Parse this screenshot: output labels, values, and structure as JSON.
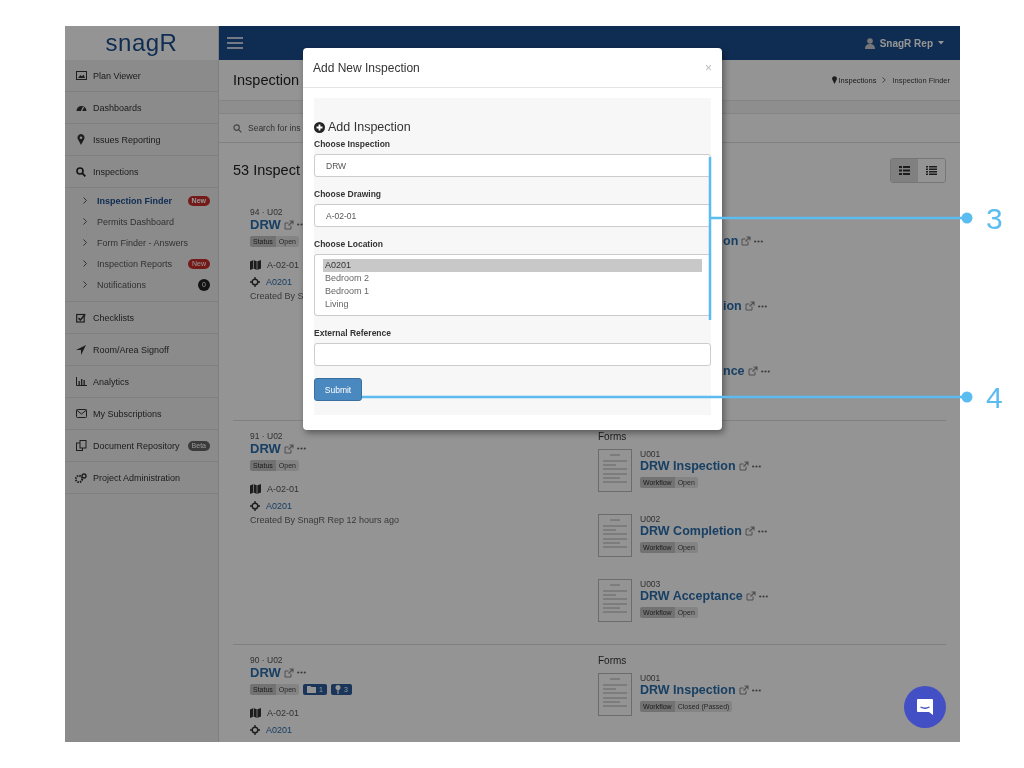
{
  "header": {
    "user": "SnagR Rep"
  },
  "sidebar": {
    "logo": "snagR",
    "items": [
      {
        "label": "Plan Viewer",
        "selected": false
      },
      {
        "label": "Dashboards",
        "selected": false
      },
      {
        "label": "Issues Reporting",
        "selected": false
      },
      {
        "label": "Inspections",
        "selected": false,
        "children": [
          {
            "label": "Inspection Finder",
            "selected": true,
            "badge": {
              "text": "New",
              "kind": "new"
            }
          },
          {
            "label": "Permits Dashboard",
            "selected": false
          },
          {
            "label": "Form Finder - Answers",
            "selected": false
          },
          {
            "label": "Inspection Reports",
            "selected": false,
            "badge": {
              "text": "New",
              "kind": "new"
            }
          },
          {
            "label": "Notifications",
            "selected": false,
            "badge": {
              "text": "0",
              "kind": "count"
            }
          }
        ]
      },
      {
        "label": "Checklists",
        "selected": false
      },
      {
        "label": "Room/Area Signoff",
        "selected": false
      },
      {
        "label": "Analytics",
        "selected": false
      },
      {
        "label": "My Subscriptions",
        "selected": false
      },
      {
        "label": "Document Repository",
        "selected": false,
        "badge": {
          "text": "Beta",
          "kind": "beta"
        }
      },
      {
        "label": "Project Administration",
        "selected": false
      }
    ]
  },
  "page": {
    "title": "Inspection",
    "breadcrumb": [
      "Inspections",
      "Inspection Finder"
    ],
    "search": {
      "placeholder": "Search for ins"
    },
    "count": "53 Inspect",
    "view_toggle": [
      {
        "selected": true
      },
      {
        "selected": false
      }
    ]
  },
  "cards": [
    {
      "kind": "covered",
      "ref": "94 · U02",
      "title": "DRW",
      "status_label": "Status",
      "status": "Open",
      "drawing": "A-02-01",
      "location": "A0201",
      "created": "Created By S",
      "forms": [
        {
          "title": "on"
        },
        {
          "title": "ion"
        },
        {
          "title": "nce"
        }
      ]
    },
    {
      "kind": "full",
      "ref": "91 · U02",
      "title": "DRW",
      "status_label": "Status",
      "status": "Open",
      "drawing": "A-02-01",
      "location": "A0201",
      "created": "Created By SnagR Rep 12 hours ago",
      "forms_heading": "Forms",
      "forms": [
        {
          "code": "U001",
          "title": "DRW Inspection",
          "workflow_label": "Workflow",
          "workflow": "Open"
        },
        {
          "code": "U002",
          "title": "DRW Completion",
          "workflow_label": "Workflow",
          "workflow": "Open"
        },
        {
          "code": "U003",
          "title": "DRW Acceptance",
          "workflow_label": "Workflow",
          "workflow": "Open"
        }
      ]
    },
    {
      "kind": "full",
      "ref": "90 · U02",
      "title": "DRW",
      "status_label": "Status",
      "status": "Open",
      "attachments": [
        {
          "kind": "folder",
          "count": "1"
        },
        {
          "kind": "pin",
          "count": "3"
        }
      ],
      "drawing": "A-02-01",
      "location": "A0201",
      "forms_heading": "Forms",
      "forms": [
        {
          "code": "U001",
          "title": "DRW Inspection",
          "workflow_label": "Workflow",
          "workflow": "Closed (Passed)"
        }
      ]
    }
  ],
  "modal": {
    "title": "Add New Inspection",
    "close": "×",
    "heading": "Add Inspection",
    "fields": [
      {
        "kind": "select",
        "label": "Choose Inspection",
        "value": "DRW"
      },
      {
        "kind": "select",
        "label": "Choose Drawing",
        "value": "A-02-01"
      },
      {
        "kind": "listbox",
        "label": "Choose Location",
        "options": [
          {
            "label": "A0201",
            "selected": true
          },
          {
            "label": "Bedroom 2",
            "selected": false
          },
          {
            "label": "Bedroom 1",
            "selected": false
          },
          {
            "label": "Living",
            "selected": false
          }
        ]
      },
      {
        "kind": "text",
        "label": "External Reference"
      }
    ],
    "submit": "Submit"
  },
  "callouts": [
    {
      "number": "3"
    },
    {
      "number": "4"
    }
  ]
}
